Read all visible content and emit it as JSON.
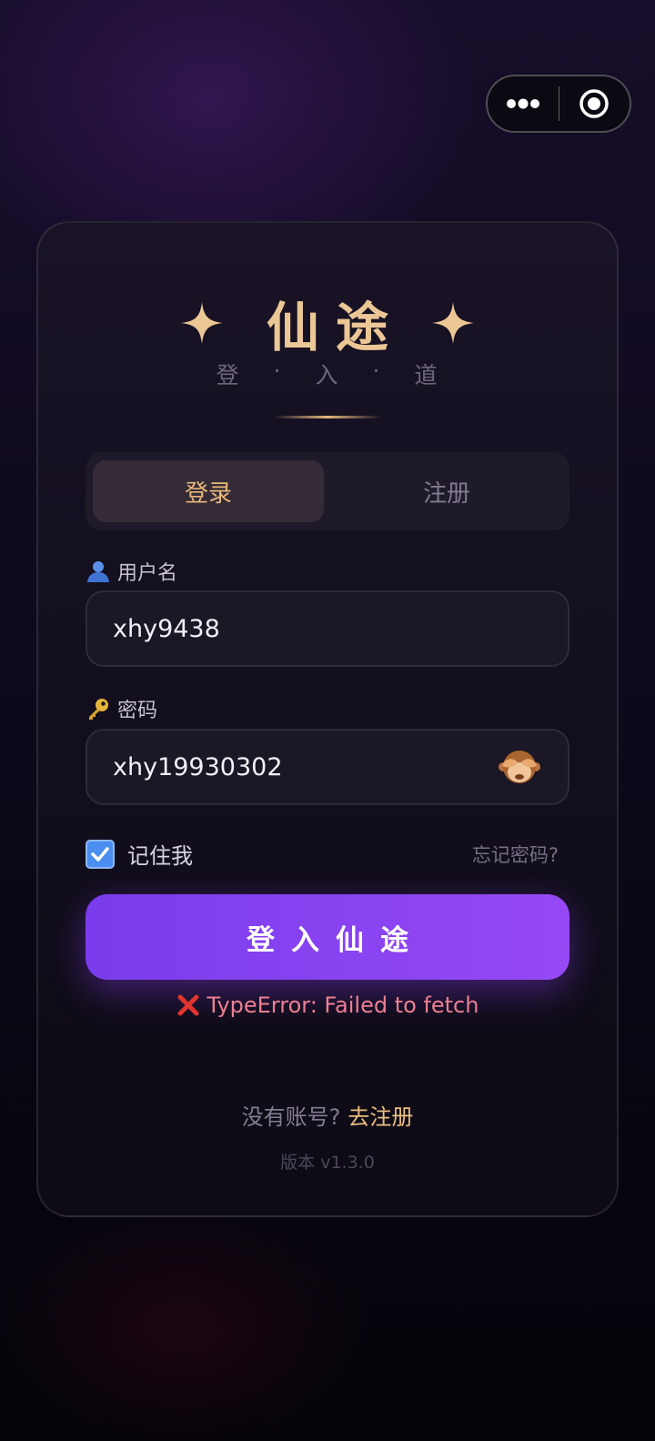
{
  "app": {
    "title": "仙途",
    "subtitle_chars": [
      "登",
      "·",
      "入",
      "·",
      "道"
    ]
  },
  "tabs": [
    {
      "label": "登录",
      "active": true
    },
    {
      "label": "注册",
      "active": false
    }
  ],
  "username": {
    "label": "用户名",
    "icon": "user-icon",
    "value": "xhy9438"
  },
  "password": {
    "label": "密码",
    "icon": "key-icon",
    "value": "xhy19930302",
    "toggle_icon": "see-no-evil-monkey-icon"
  },
  "remember": {
    "label": "记住我",
    "checked": true
  },
  "forgot_label": "忘记密码?",
  "login_button": "登入仙途",
  "error": {
    "icon": "cross-mark-icon",
    "message": "TypeError: Failed to fetch"
  },
  "signup": {
    "question": "没有账号?",
    "link": "去注册"
  },
  "version": "版本 v1.3.0",
  "colors": {
    "accent_gold": "#ecc796",
    "button_purple": "#8a44f2",
    "error_red": "#ec7f92",
    "checkbox_blue": "#4b8ef0"
  }
}
